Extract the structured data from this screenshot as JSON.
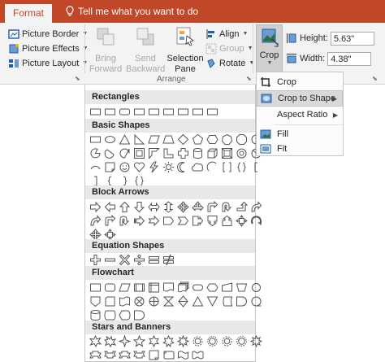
{
  "tabbar": {
    "active_tab": "Format",
    "tell_me": "Tell me what you want to do"
  },
  "ribbon": {
    "picture_border": "Picture Border",
    "picture_effects": "Picture Effects",
    "picture_layout": "Picture Layout",
    "bring_forward": [
      "Bring",
      "Forward"
    ],
    "send_backward": [
      "Send",
      "Backward"
    ],
    "selection_pane": [
      "Selection",
      "Pane"
    ],
    "align": "Align",
    "group": "Group",
    "rotate": "Rotate",
    "arrange_group": "Arrange",
    "crop": "Crop",
    "height_label": "Height:",
    "height_value": "5.63\"",
    "width_label": "Width:",
    "width_value": "4.38\""
  },
  "shapes": {
    "sections": [
      {
        "name": "Rectangles",
        "rows": 1
      },
      {
        "name": "Basic Shapes",
        "rows": 4
      },
      {
        "name": "Block Arrows",
        "rows": 3
      },
      {
        "name": "Equation Shapes",
        "rows": 1
      },
      {
        "name": "Flowchart",
        "rows": 3
      },
      {
        "name": "Stars and Banners",
        "rows": 2
      }
    ]
  },
  "crop_menu": {
    "items": [
      {
        "label": "Crop",
        "icon": "crop-icon",
        "submenu": false,
        "highlighted": false
      },
      {
        "label": "Crop to Shape",
        "icon": "crop-to-shape-icon",
        "submenu": true,
        "highlighted": true
      },
      {
        "label": "Aspect Ratio",
        "icon": "",
        "submenu": true,
        "highlighted": false
      },
      {
        "label": "Fill",
        "icon": "fill-icon",
        "submenu": false,
        "highlighted": false
      },
      {
        "label": "Fit",
        "icon": "fit-icon",
        "submenu": false,
        "highlighted": false
      }
    ]
  },
  "colors": {
    "accent": "#c14729",
    "ribbon_bg": "#f3f3f3",
    "section_header_bg": "#e8e8e8"
  }
}
